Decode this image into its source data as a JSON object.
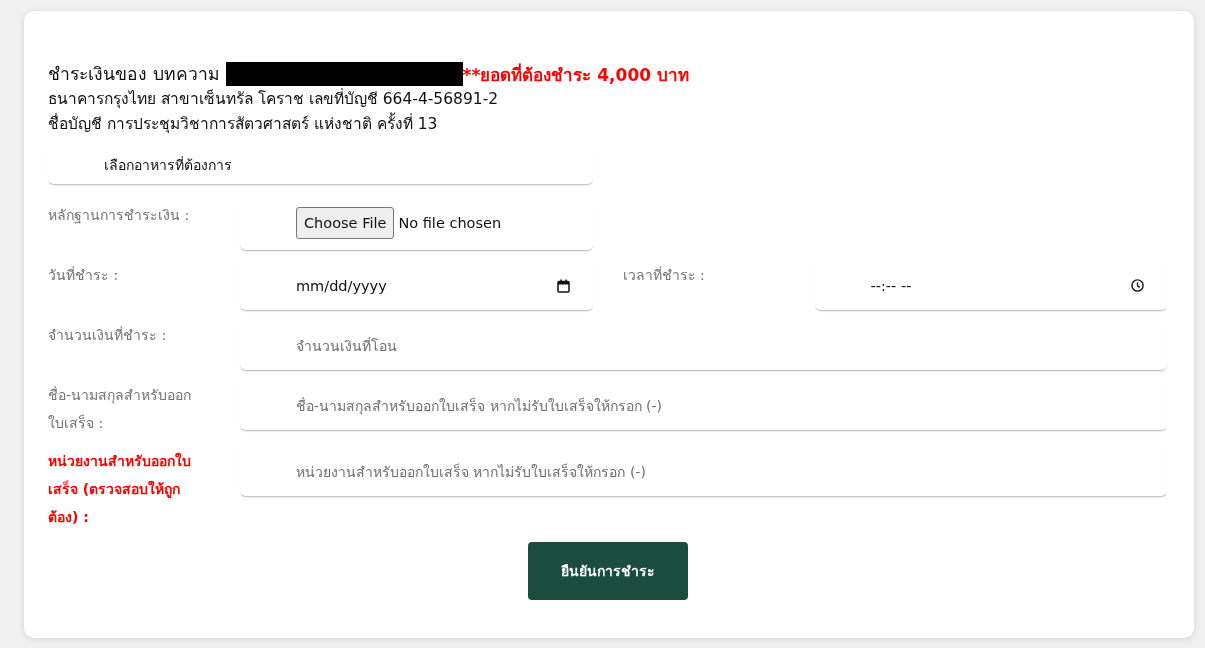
{
  "payment_header": {
    "title": "ชำระเงินของ บทความ",
    "amount_due": "**ยอดที่ต้องชำระ 4,000 บาท",
    "bank_account": "ธนาคารกรุงไทย สาขาเซ็นทรัล โคราช เลขที่บัญชี 664-4-56891-2",
    "account_name": "ชื่อบัญชี การประชุมวิชาการสัตวศาสตร์ แห่งชาติ ครั้งที่ 13"
  },
  "food_select": {
    "value": "เลือกอาหารที่ต้องการ"
  },
  "form_rows": [
    {
      "fields": [
        {
          "kind": "file",
          "label": "หลักฐานการชำระเงิน :",
          "emphasized": false,
          "button": "Choose File",
          "status": "No file chosen"
        }
      ]
    },
    {
      "fields": [
        {
          "kind": "date",
          "label": "วันที่ชำระ :",
          "emphasized": false,
          "value": "mm/dd/yyyy"
        },
        {
          "kind": "time",
          "label": "เวลาที่ชำระ :",
          "emphasized": false,
          "value": "--:-- --"
        }
      ]
    },
    {
      "fields": [
        {
          "kind": "text",
          "label": "จำนวนเงินที่ชำระ :",
          "emphasized": false,
          "placeholder": "จำนวนเงินที่โอน"
        }
      ]
    },
    {
      "fields": [
        {
          "kind": "text",
          "label": "ชื่อ-นามสกุลสำหรับออกใบเสร็จ :",
          "emphasized": false,
          "placeholder": "ชื่อ-นามสกุลสำหรับออกใบเสร็จ หากไม่รับใบเสร็จให้กรอก (-)"
        }
      ]
    },
    {
      "fields": [
        {
          "kind": "text",
          "label": "หน่วยงานสำหรับออกใบเสร็จ (ตรวจสอบให้ถูกต้อง) :",
          "emphasized": true,
          "placeholder": "หน่วยงานสำหรับออกใบเสร็จ หากไม่รับใบเสร็จให้กรอก (-)"
        }
      ]
    }
  ],
  "submit_button": "ยืนยันการชำระ"
}
